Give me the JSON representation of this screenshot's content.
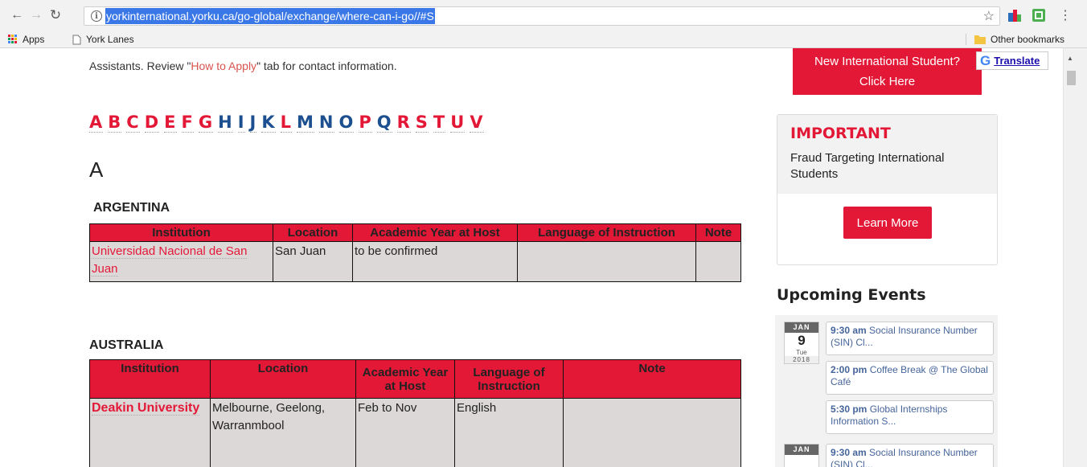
{
  "browser": {
    "url": "yorkinternational.yorku.ca/go-global/exchange/where-can-i-go//#S",
    "bookmarks": [
      "Apps",
      "York Lanes"
    ],
    "other_bookmarks": "Other bookmarks"
  },
  "intro": {
    "text_before": "Assistants. Review \"",
    "link": "How to Apply",
    "text_after": "\" tab for contact information."
  },
  "letters": [
    "A",
    "B",
    "C",
    "D",
    "E",
    "F",
    "G",
    "H",
    "I",
    "J",
    "K",
    "L",
    "M",
    "N",
    "O",
    "P",
    "Q",
    "R",
    "S",
    "T",
    "U",
    "V"
  ],
  "section_heading": "A",
  "argentina": {
    "country": "ARGENTINA",
    "headers": [
      "Institution",
      "Location",
      "Academic Year at Host",
      "Language of Instruction",
      "Note"
    ],
    "row": {
      "institution": "Universidad Nacional de San Juan",
      "location": "San Juan",
      "year": "to be confirmed",
      "language": "",
      "note": ""
    }
  },
  "australia": {
    "country": "AUSTRALIA",
    "headers": [
      "Institution",
      "Location",
      "Academic Year at Host",
      "Language of Instruction",
      "Note"
    ],
    "row": {
      "institution": "Deakin University",
      "location": "Melbourne, Geelong, Warranmbool",
      "year": "Feb to Nov",
      "language": "English",
      "note": ""
    }
  },
  "sidebar": {
    "new_student_line1": "New International Student?",
    "new_student_line2": "Click Here",
    "translate": "Translate",
    "important_title": "IMPORTANT",
    "important_text": "Fraud Targeting International Students",
    "learn_more": "Learn More",
    "events_title": "Upcoming Events",
    "cal1": {
      "month": "JAN",
      "day": "9",
      "weekday": "Tue",
      "year": "2018"
    },
    "cal2": {
      "month": "JAN"
    },
    "events": [
      {
        "time": "9:30 am",
        "title": "Social Insurance Number (SIN) Cl..."
      },
      {
        "time": "2:00 pm",
        "title": "Coffee Break @ The Global Café"
      },
      {
        "time": "5:30 pm",
        "title": "Global Internships Information S..."
      },
      {
        "time": "9:30 am",
        "title": "Social Insurance Number (SIN) Cl..."
      }
    ]
  }
}
